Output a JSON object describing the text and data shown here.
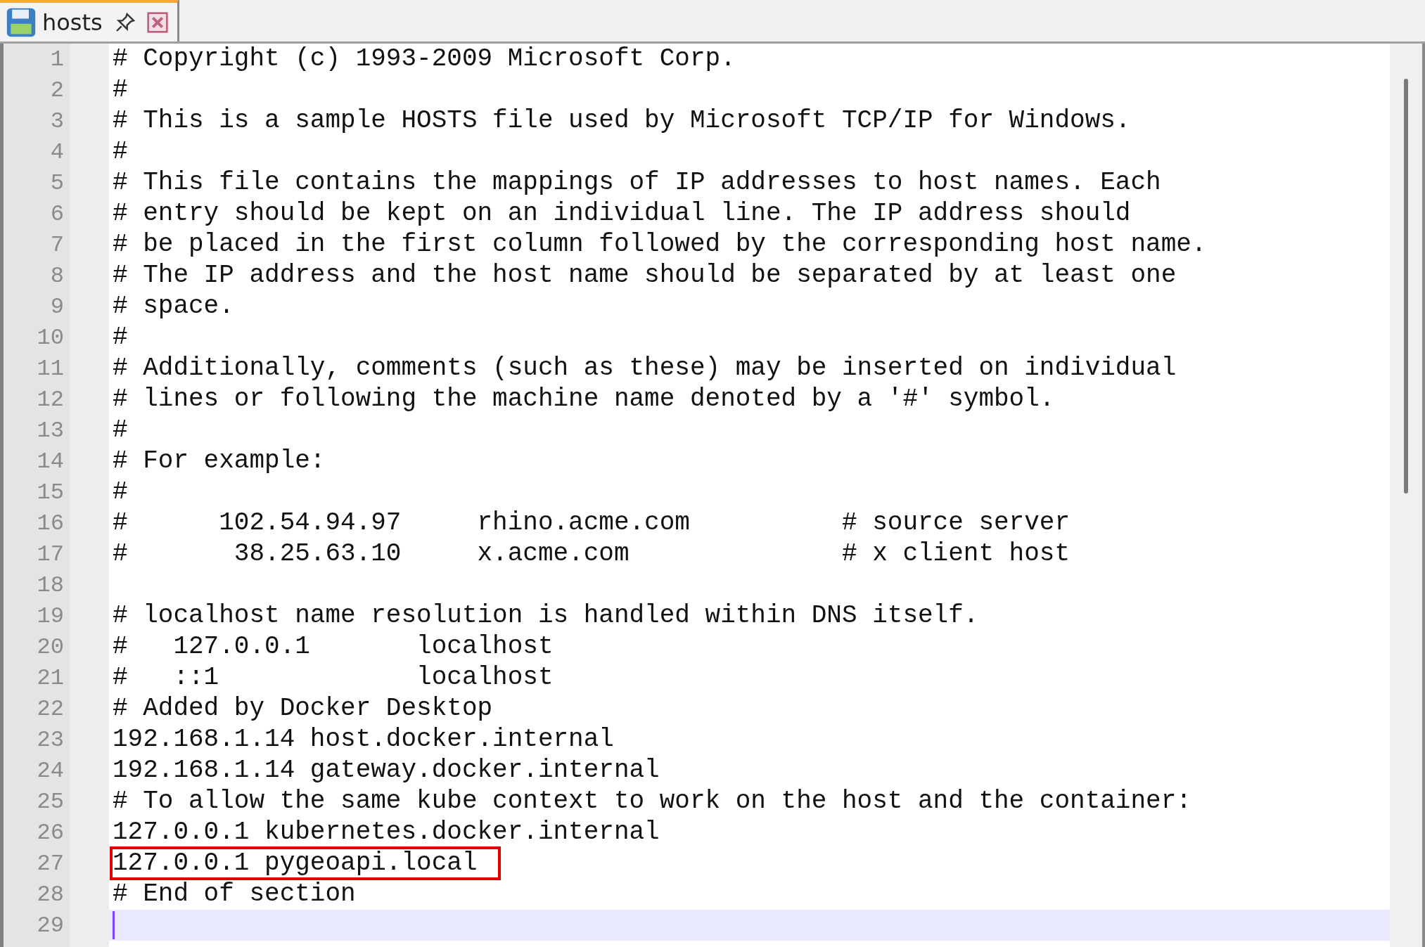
{
  "tabs": [
    {
      "label": "hosts",
      "selected": true
    }
  ],
  "editor": {
    "lines": [
      {
        "number": "1",
        "text": "# Copyright (c) 1993-2009 Microsoft Corp."
      },
      {
        "number": "2",
        "text": "#"
      },
      {
        "number": "3",
        "text": "# This is a sample HOSTS file used by Microsoft TCP/IP for Windows."
      },
      {
        "number": "4",
        "text": "#"
      },
      {
        "number": "5",
        "text": "# This file contains the mappings of IP addresses to host names. Each"
      },
      {
        "number": "6",
        "text": "# entry should be kept on an individual line. The IP address should"
      },
      {
        "number": "7",
        "text": "# be placed in the first column followed by the corresponding host name."
      },
      {
        "number": "8",
        "text": "# The IP address and the host name should be separated by at least one"
      },
      {
        "number": "9",
        "text": "# space."
      },
      {
        "number": "10",
        "text": "#"
      },
      {
        "number": "11",
        "text": "# Additionally, comments (such as these) may be inserted on individual"
      },
      {
        "number": "12",
        "text": "# lines or following the machine name denoted by a '#' symbol."
      },
      {
        "number": "13",
        "text": "#"
      },
      {
        "number": "14",
        "text": "# For example:"
      },
      {
        "number": "15",
        "text": "#"
      },
      {
        "number": "16",
        "text": "#      102.54.94.97     rhino.acme.com          # source server"
      },
      {
        "number": "17",
        "text": "#       38.25.63.10     x.acme.com              # x client host"
      },
      {
        "number": "18"
      },
      {
        "number": "19",
        "text": "# localhost name resolution is handled within DNS itself."
      },
      {
        "number": "20",
        "text": "#   127.0.0.1       localhost"
      },
      {
        "number": "21",
        "text": "#   ::1             localhost"
      },
      {
        "number": "22",
        "text": "# Added by Docker Desktop"
      },
      {
        "number": "23",
        "text": "192.168.1.14 host.docker.internal"
      },
      {
        "number": "24",
        "text": "192.168.1.14 gateway.docker.internal"
      },
      {
        "number": "25",
        "text": "# To allow the same kube context to work on the host and the container:"
      },
      {
        "number": "26",
        "text": "127.0.0.1 kubernetes.docker.internal"
      },
      {
        "number": "27",
        "text": "127.0.0.1 pygeoapi.local",
        "marked": true
      },
      {
        "number": "28",
        "text": "# End of section"
      },
      {
        "number": "29",
        "current": true
      }
    ]
  }
}
